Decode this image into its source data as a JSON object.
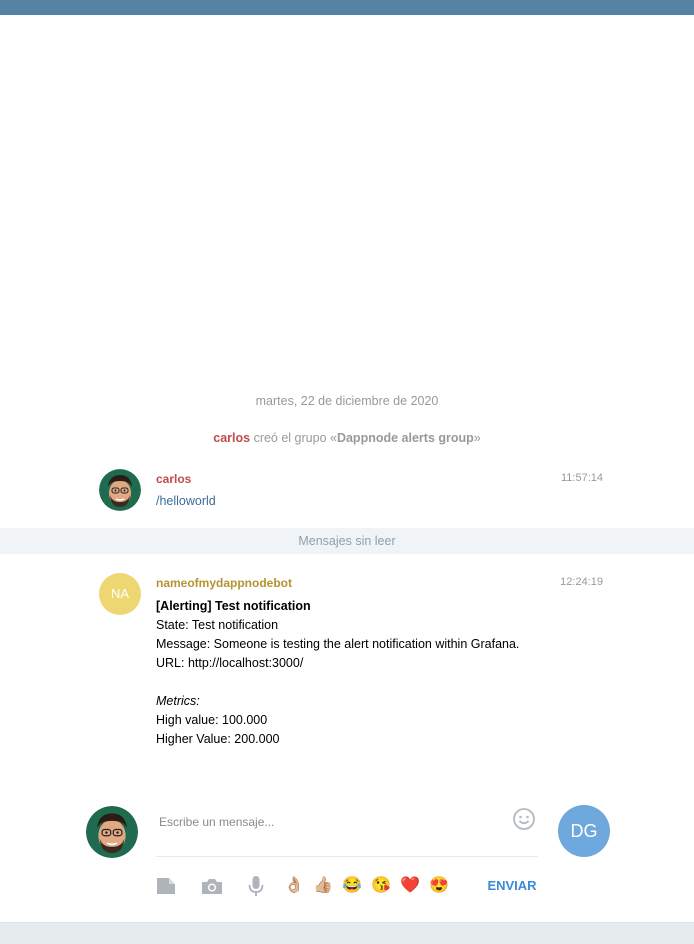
{
  "date_separator": "martes, 22 de diciembre de 2020",
  "service_message": {
    "user": "carlos",
    "text_before": " creó el grupo «",
    "group": "Dappnode alerts group",
    "text_after": "»"
  },
  "messages": [
    {
      "author": "carlos",
      "author_color": "#c24b4b",
      "time": "11:57:14",
      "text": "/helloworld",
      "text_color": "#3a6d99"
    },
    {
      "author": "nameofmydappnodebot",
      "author_color": "#b5932f",
      "avatar_initials": "NA",
      "avatar_color": "#eed673",
      "time": "12:24:19",
      "lines": {
        "title": "[Alerting] Test notification",
        "state": "State: Test notification",
        "message": "Message: Someone is testing the alert notification within Grafana.",
        "url": "URL: http://localhost:3000/",
        "metrics_label": "Metrics:",
        "high": "High value: 100.000",
        "higher": "Higher Value: 200.000"
      }
    }
  ],
  "unread_label": "Mensajes sin leer",
  "composer": {
    "placeholder": "Escribe un mensaje...",
    "send_label": "ENVIAR",
    "peer_initials": "DG",
    "peer_color": "#6fa8dc",
    "emojis": [
      "👌🏼",
      "👍🏼",
      "😂",
      "😘",
      "❤️",
      "😍"
    ],
    "icons": [
      "attach-file-icon",
      "camera-icon",
      "microphone-icon",
      "smile-icon"
    ]
  },
  "colors": {
    "header": "#5682a3",
    "accent": "#3a8bd8"
  }
}
